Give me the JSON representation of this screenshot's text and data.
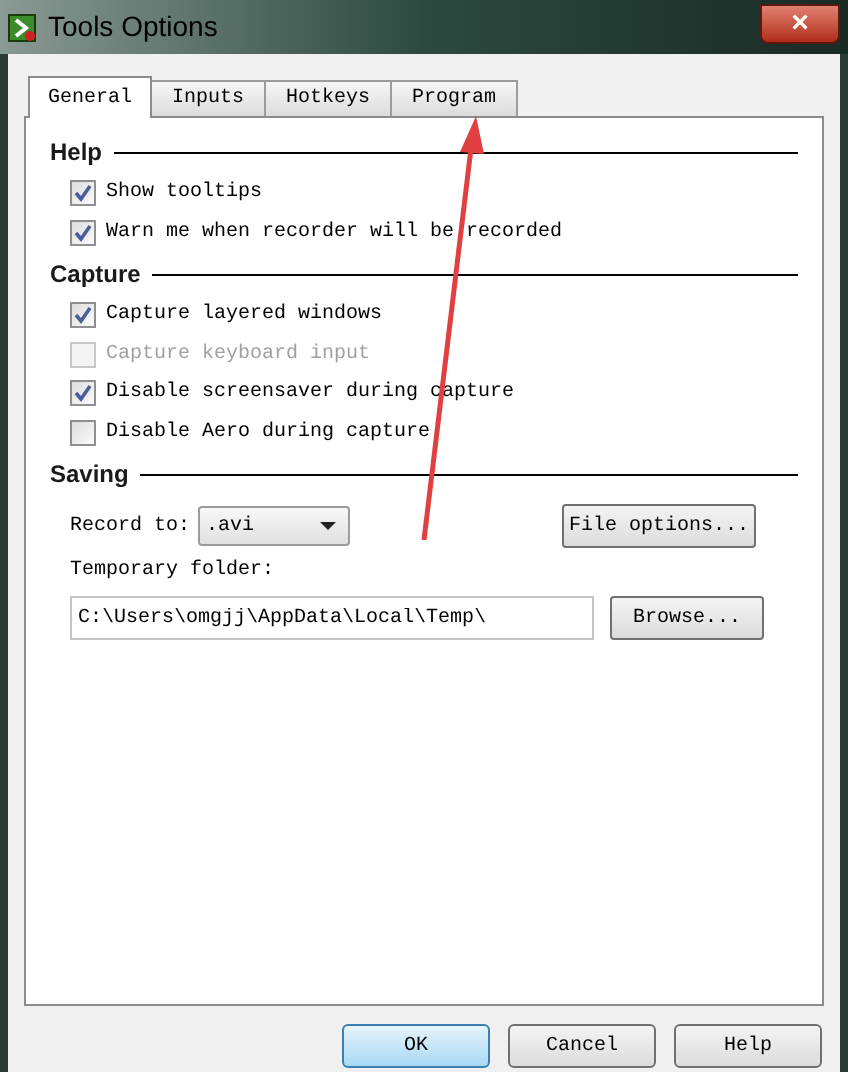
{
  "window": {
    "title": "Tools Options",
    "close": "×"
  },
  "tabs": [
    {
      "label": "General",
      "selected": true
    },
    {
      "label": "Inputs",
      "selected": false
    },
    {
      "label": "Hotkeys",
      "selected": false
    },
    {
      "label": "Program",
      "selected": false
    }
  ],
  "sections": [
    {
      "title": "Help",
      "options": [
        {
          "label": "Show tooltips",
          "checked": true,
          "disabled": false
        },
        {
          "label": "Warn me when recorder will be recorded",
          "checked": true,
          "disabled": false
        }
      ]
    },
    {
      "title": "Capture",
      "options": [
        {
          "label": "Capture layered windows",
          "checked": true,
          "disabled": false
        },
        {
          "label": "Capture keyboard input",
          "checked": false,
          "disabled": true
        },
        {
          "label": "Disable screensaver during capture",
          "checked": true,
          "disabled": false
        },
        {
          "label": "Disable Aero during capture",
          "checked": false,
          "disabled": false
        }
      ]
    },
    {
      "title": "Saving"
    }
  ],
  "saving": {
    "record_label": "Record to:",
    "record_value": ".avi",
    "file_options": "File options...",
    "folder_label": "Temporary folder:",
    "folder_value": "C:\\Users\\omgjj\\AppData\\Local\\Temp\\",
    "browse": "Browse..."
  },
  "buttons": [
    {
      "label": "OK",
      "default": true
    },
    {
      "label": "Cancel",
      "default": false
    },
    {
      "label": "Help",
      "default": false
    }
  ]
}
